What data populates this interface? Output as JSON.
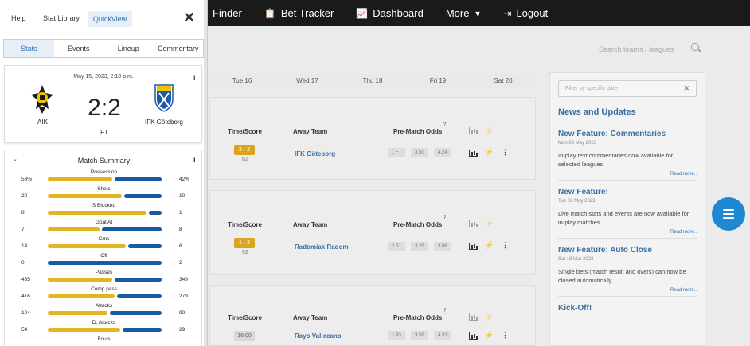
{
  "nav": {
    "finder": "Finder",
    "bet_tracker": "Bet Tracker",
    "dashboard": "Dashboard",
    "more": "More",
    "logout": "Logout"
  },
  "search": {
    "placeholder": "Search teams / leagues"
  },
  "days": [
    "Tue 16",
    "Wed 17",
    "Thu 18",
    "Fri 19",
    "Sat 20"
  ],
  "headers": {
    "time_score": "Time/Score",
    "away_team": "Away Team",
    "odds": "Pre-Match Odds",
    "odds_sup": "?"
  },
  "fixtures": [
    {
      "score": "2 - 2",
      "sub": "82",
      "away": "IFK Göteborg",
      "odds": [
        "1 FT",
        "3.50",
        "4.24"
      ],
      "live": true
    },
    {
      "score": "1 - 2",
      "sub": "92",
      "away": "Radomiak Radom",
      "odds": [
        "2.51",
        "3.25",
        "3.06"
      ],
      "live": true
    },
    {
      "score": "16:00",
      "sub": "",
      "away": "Rayo Vallecano",
      "odds": [
        "1.93",
        "3.59",
        "4.31"
      ],
      "live": false
    }
  ],
  "news": {
    "filter_placeholder": "Filter by specific date",
    "title": "News and Updates",
    "items": [
      {
        "title": "New Feature: Commentaries",
        "date": "Mon 08 May 2023",
        "body": "In-play text commentaries now available for selected leagues",
        "more": "Read more.."
      },
      {
        "title": "New Feature!",
        "date": "Tue 02 May 2023",
        "body": "Live match stats and events are now available for in-play matches",
        "more": "Read more.."
      },
      {
        "title": "New Feature: Auto Close",
        "date": "Sat 18 Mar 2023",
        "body": "Single bets (match result and overs) can now be closed automatically",
        "more": "Read more.."
      },
      {
        "title": "Kick-Off!",
        "date": "",
        "body": "",
        "more": ""
      }
    ]
  },
  "panel": {
    "help": "Help",
    "stat_library": "Stat Library",
    "quickview": "QuickView",
    "close": "✕",
    "tabs": [
      "Stats",
      "Events",
      "Lineup",
      "Commentary"
    ],
    "match": {
      "date": "May 15, 2023, 2:10 p.m.",
      "home": "AIK",
      "away": "IFK Göteborg",
      "score": "2:2",
      "status": "FT",
      "info": "i"
    },
    "summary_title": "Match Summary",
    "stats": [
      {
        "name": "Possession",
        "home": "58%",
        "away": "42%",
        "h": 58,
        "a": 42
      },
      {
        "name": "Shots",
        "home": "20",
        "away": "10",
        "h": 20,
        "a": 10
      },
      {
        "name": "S Blocked",
        "home": "8",
        "away": "1",
        "h": 8,
        "a": 1
      },
      {
        "name": "Goal At",
        "home": "7",
        "away": "8",
        "h": 7,
        "a": 8
      },
      {
        "name": "Crns",
        "home": "14",
        "away": "6",
        "h": 14,
        "a": 6
      },
      {
        "name": "Off",
        "home": "0",
        "away": "2",
        "h": 0,
        "a": 2
      },
      {
        "name": "Passes",
        "home": "485",
        "away": "349",
        "h": 485,
        "a": 349
      },
      {
        "name": "Comp pass",
        "home": "416",
        "away": "279",
        "h": 416,
        "a": 279
      },
      {
        "name": "Attacks",
        "home": "104",
        "away": "90",
        "h": 104,
        "a": 90
      },
      {
        "name": "D. Attacks",
        "home": "54",
        "away": "29",
        "h": 54,
        "a": 29
      },
      {
        "name": "Fouls",
        "home": "",
        "away": "",
        "h": 0,
        "a": 0
      }
    ]
  }
}
